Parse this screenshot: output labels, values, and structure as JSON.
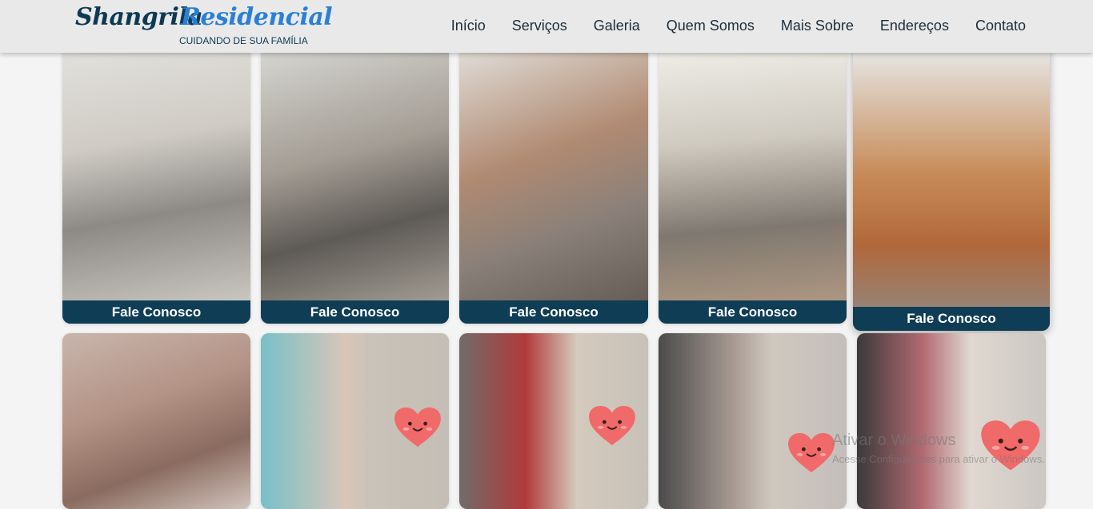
{
  "header": {
    "logo": {
      "word1": "Shangrila",
      "word2": "Residencial",
      "tagline": "CUIDANDO DE SUA FAMÍLIA"
    },
    "nav": [
      "Início",
      "Serviços",
      "Galeria",
      "Quem Somos",
      "Mais Sobre",
      "Endereços",
      "Contato"
    ]
  },
  "gallery": {
    "cta_label": "Fale Conosco",
    "row1_count": 5,
    "row2_count": 5
  },
  "watermark": {
    "title": "Ativar o Windows",
    "subtitle": "Acesse Configurações para ativar o Windows."
  },
  "colors": {
    "header_bg": "#e9e9e9",
    "brand_dark": "#0d3a52",
    "brand_blue": "#2b7fd4",
    "cta_bg": "#0f3d55",
    "heart": "#f06a6a"
  }
}
